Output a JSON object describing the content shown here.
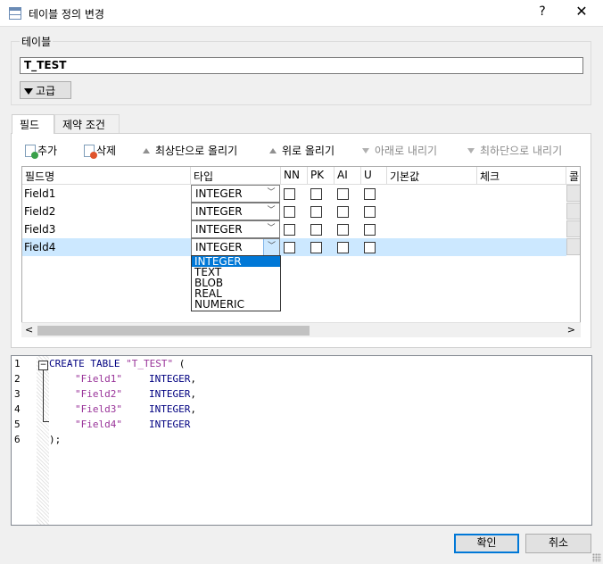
{
  "window": {
    "title": "테이블 정의 변경",
    "help": "?",
    "close": "✕"
  },
  "table_group": {
    "label": "테이블",
    "name_value": "T_TEST",
    "advanced_label": "고급"
  },
  "tabs": [
    {
      "label": "필드",
      "active": true
    },
    {
      "label": "제약 조건",
      "active": false
    }
  ],
  "toolbar": {
    "add": "추가",
    "delete": "삭제",
    "move_top": "최상단으로 올리기",
    "move_up": "위로 올리기",
    "move_down": "아래로 내리기",
    "move_bottom": "최하단으로 내리기"
  },
  "grid": {
    "columns": [
      "필드명",
      "타입",
      "NN",
      "PK",
      "AI",
      "U",
      "기본값",
      "체크",
      "콜"
    ],
    "rows": [
      {
        "name": "Field1",
        "type": "INTEGER",
        "nn": false,
        "pk": false,
        "ai": false,
        "u": false,
        "selected": false
      },
      {
        "name": "Field2",
        "type": "INTEGER",
        "nn": false,
        "pk": false,
        "ai": false,
        "u": false,
        "selected": false
      },
      {
        "name": "Field3",
        "type": "INTEGER",
        "nn": false,
        "pk": false,
        "ai": false,
        "u": false,
        "selected": false
      },
      {
        "name": "Field4",
        "type": "INTEGER",
        "nn": false,
        "pk": false,
        "ai": false,
        "u": false,
        "selected": true
      }
    ],
    "type_options": [
      "INTEGER",
      "TEXT",
      "BLOB",
      "REAL",
      "NUMERIC"
    ],
    "type_highlighted": "INTEGER"
  },
  "sql": {
    "line_numbers": [
      "1",
      "2",
      "3",
      "4",
      "5",
      "6"
    ],
    "create_kw": "CREATE TABLE",
    "table_name": "\"T_TEST\"",
    "open_paren": " (",
    "fields": [
      {
        "name": "\"Field1\"",
        "type": "INTEGER",
        "sep": ","
      },
      {
        "name": "\"Field2\"",
        "type": "INTEGER",
        "sep": ","
      },
      {
        "name": "\"Field3\"",
        "type": "INTEGER",
        "sep": ","
      },
      {
        "name": "\"Field4\"",
        "type": "INTEGER",
        "sep": ""
      }
    ],
    "close": ");"
  },
  "buttons": {
    "ok": "확인",
    "cancel": "취소"
  },
  "colors": {
    "selection": "#cce8ff",
    "highlight": "#0078d7",
    "keyword": "#000080",
    "string": "#993399"
  }
}
